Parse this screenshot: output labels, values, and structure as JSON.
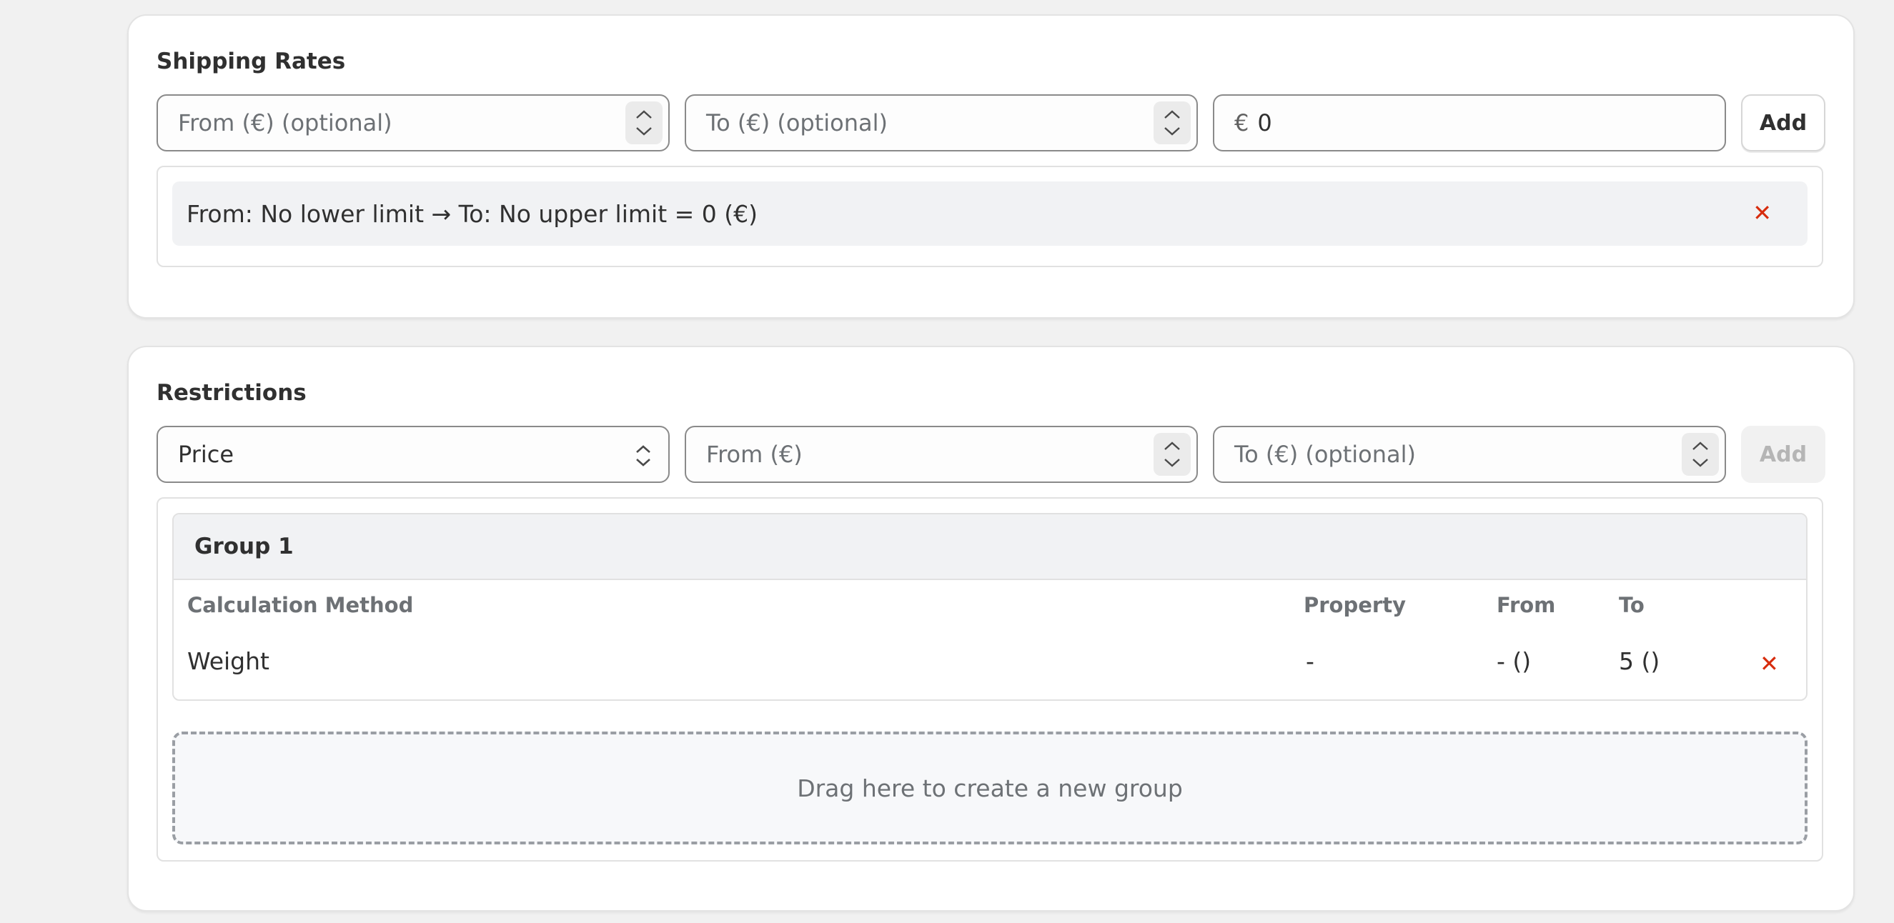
{
  "shipping_rates": {
    "title": "Shipping Rates",
    "from_placeholder": "From (€) (optional)",
    "to_placeholder": "To (€) (optional)",
    "price_prefix": "€",
    "price_value": "0",
    "add_label": "Add",
    "rates": [
      {
        "text": "From: No lower limit → To: No upper limit = 0 (€)"
      }
    ]
  },
  "restrictions": {
    "title": "Restrictions",
    "type_select_value": "Price",
    "from_placeholder": "From (€)",
    "to_placeholder": "To (€) (optional)",
    "add_label": "Add",
    "add_disabled": true,
    "groups": [
      {
        "name": "Group 1",
        "columns": [
          "Calculation Method",
          "Property",
          "From",
          "To"
        ],
        "rows": [
          {
            "method": "Weight",
            "property": "-",
            "from": "- ()",
            "to": "5 ()"
          }
        ]
      }
    ],
    "dropzone_text": "Drag here to create a new group"
  },
  "colors": {
    "background": "#f1f1f1",
    "card": "#ffffff",
    "remove_icon": "#d72c0d",
    "muted_text": "#6d7175"
  }
}
